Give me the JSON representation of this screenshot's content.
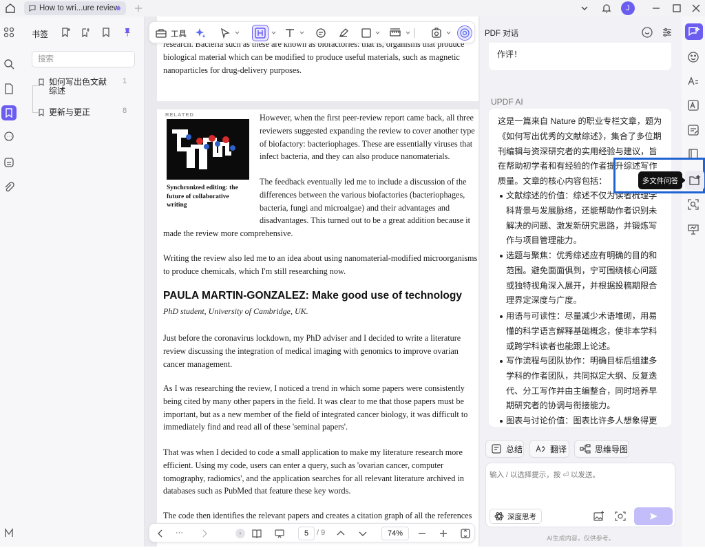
{
  "titlebar": {
    "tab_title": "How to wri...ure review",
    "avatar_initial": "J"
  },
  "bookmarks": {
    "title": "书签",
    "search_placeholder": "搜索",
    "items": [
      {
        "label": "如何写出色文献综述",
        "count": "1"
      },
      {
        "label": "更新与更正",
        "count": "8"
      }
    ]
  },
  "toolbar": {
    "tools_label": "工具"
  },
  "document": {
    "page1_text": "biological material which can be modified to produce useful materials, such as magnetic nanoparticles for drug-delivery purposes.",
    "page1_line1": "research. Bacteria such as these are known as biofactories: that is, organisms that produce",
    "related_tag": "RELATED",
    "related_caption": "Synchronized editing: the future of collaborative writing",
    "p_feedback1": "However, when the first peer-review report came back, all three reviewers suggested expanding the review to cover another type of biofactory: bacteriophages. These are essentially viruses that infect bacteria, and they can also produce nanomaterials.",
    "p_feedback2": "The feedback eventually led me to include a discussion of the differences between the various biofactories (bacteriophages, bacteria, fungi and microalgae) and their advantages and disadvantages. This turned out to be a great addition because it",
    "p_feedback2_end": "made the review more comprehensive.",
    "p_writing": "Writing the review also led me to an idea about using nanomaterial-modified microorganisms to produce chemicals, which I'm still researching now.",
    "heading": "PAULA MARTIN-GONZALEZ: Make good use of technology",
    "subheading": "PhD student, University of Cambridge, UK.",
    "p_lockdown": "Just before the coronavirus lockdown, my PhD adviser and I decided to write a literature review discussing the integration of medical imaging with genomics to improve ovarian cancer management.",
    "p_trend": "As I was researching the review, I noticed a trend in which some papers were consistently being cited by many other papers in the field. It was clear to me that those papers must be important, but as a new member of the field of integrated cancer biology, it was difficult to immediately find and read all of these 'seminal papers'.",
    "p_app": "That was when I decided to code a small application to make my literature research more efficient. Using my code, users can enter a query, such as 'ovarian cancer, computer tomography, radiomics', and the application searches for all relevant literature archived in databases such as PubMed that feature these key words.",
    "p_code": "The code then identifies the relevant papers and creates a citation graph of all the references"
  },
  "bottombar": {
    "current_page": "5",
    "total_pages": "/ 9",
    "zoom": "74%",
    "ellipsis": "···"
  },
  "chat": {
    "title": "PDF 对话",
    "prev_message": "作评！",
    "ai_label": "UPDF AI",
    "intro": "这是一篇来自 Nature 的职业专栏文章，题为《如何写出优秀的文献综述》，集合了多位期刊编辑与资深研究者的实用经验与建议，旨在帮助初学者和有经验的作者提升综述写作质量。文章的核心内容包括：",
    "bullets": [
      "文献综述的价值：综述不仅为读者梳理学科背景与发展脉络，还能帮助作者识别未解决的问题、激发新研究思路，并锻炼写作与项目管理能力。",
      "选题与聚焦：优秀综述应有明确的目的和范围。避免面面俱到，宁可围绕核心问题或独特视角深入展开，并根据投稿期限合理界定深度与广度。",
      "用语与可读性：尽量减少术语堆砌，用易懂的科学语言解释基础概念，使非本学科或跨学科读者也能跟上论述。",
      "写作流程与团队协作：明确目标后组建多学科的作者团队，共同拟定大纲、反复迭代、分工写作并由主编整合，同时培养早期研究者的协调与衔接能力。",
      "图表与讨论价值：图表比许多人想象得更"
    ],
    "actions": {
      "summarize": "总结",
      "translate": "翻译",
      "mindmap": "思维导图"
    },
    "input_placeholder": "输入 / 以选择提示，按 ⏎ 以发送。",
    "deep_think": "深度思考",
    "disclaimer": "AI生成内容，仅供参考。",
    "tooltip": "多文件问答"
  },
  "colors": {
    "accent": "#6b5df0",
    "highlight": "#1e63d2"
  }
}
